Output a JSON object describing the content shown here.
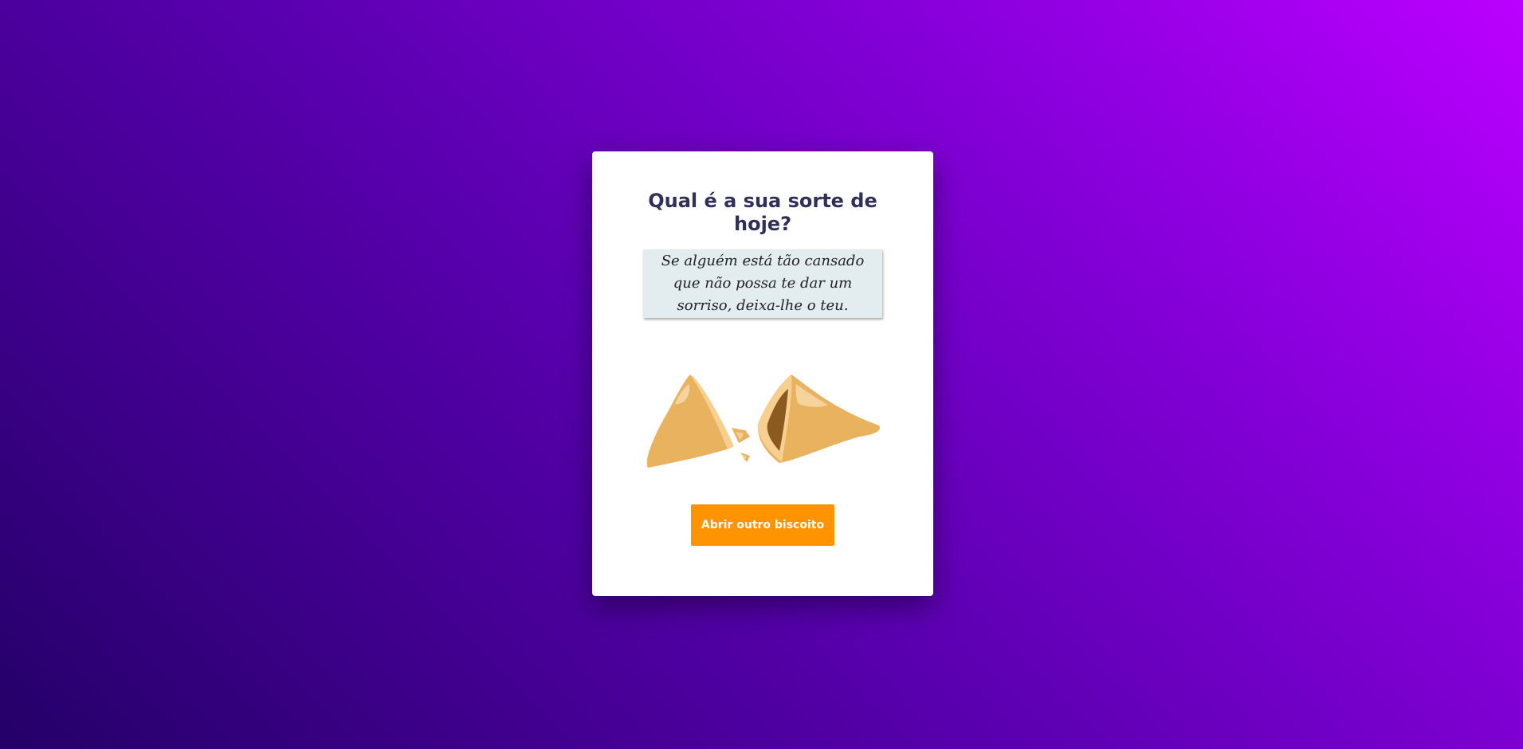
{
  "card": {
    "title_line1": "Qual é a sua sorte de",
    "title_line2": "hoje?",
    "fortune_text": "Se alguém está tão cansado que não possa te dar um sorriso, deixa-lhe o teu.",
    "cookie_icon": "broken-fortune-cookie-icon",
    "button_label": "Abrir outro biscoito"
  },
  "colors": {
    "background_start": "#240068",
    "background_end": "#bb00ff",
    "title": "#2f2f58",
    "fortune_paper": "#e3ecef",
    "button": "#ff9400",
    "button_text": "#ffffff"
  }
}
